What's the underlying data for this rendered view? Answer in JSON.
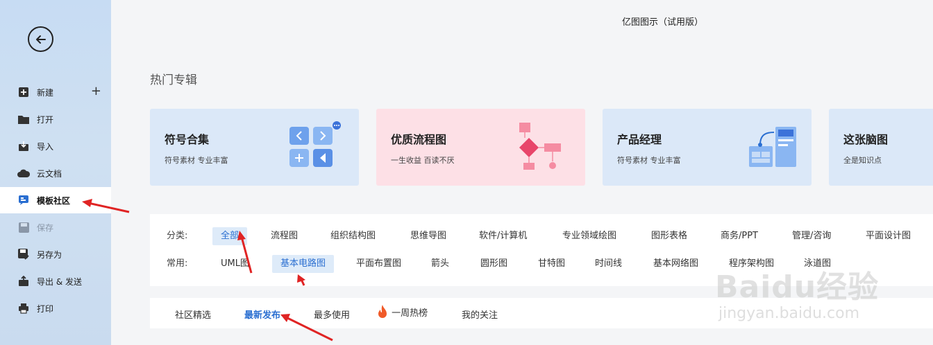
{
  "app_title": "亿图图示（试用版）",
  "sidebar": {
    "items": [
      {
        "label": "新建",
        "icon": "plus-square-icon"
      },
      {
        "label": "打开",
        "icon": "folder-icon"
      },
      {
        "label": "导入",
        "icon": "import-icon"
      },
      {
        "label": "云文档",
        "icon": "cloud-icon"
      },
      {
        "label": "模板社区",
        "icon": "template-community-icon"
      },
      {
        "label": "保存",
        "icon": "save-icon"
      },
      {
        "label": "另存为",
        "icon": "save-as-icon"
      },
      {
        "label": "导出 & 发送",
        "icon": "export-icon"
      },
      {
        "label": "打印",
        "icon": "printer-icon"
      }
    ],
    "active_index": 4,
    "disabled_index": 5
  },
  "section_title": "热门专辑",
  "cards": [
    {
      "title": "符号合集",
      "subtitle": "符号素材 专业丰富",
      "bg": "#dbe8f8"
    },
    {
      "title": "优质流程图",
      "subtitle": "一生收益 百读不厌",
      "bg": "#fde0e6"
    },
    {
      "title": "产品经理",
      "subtitle": "符号素材 专业丰富",
      "bg": "#dbe8f8"
    },
    {
      "title": "这张脑图",
      "subtitle": "全是知识点",
      "bg": "#dbe8f8"
    }
  ],
  "categories": {
    "label": "分类:",
    "items": [
      "全部",
      "流程图",
      "组织结构图",
      "思维导图",
      "软件/计算机",
      "专业领域绘图",
      "图形表格",
      "商务/PPT",
      "管理/咨询",
      "平面设计图"
    ],
    "selected": "全部"
  },
  "common": {
    "label": "常用:",
    "items": [
      "UML图",
      "基本电路图",
      "平面布置图",
      "箭头",
      "圆形图",
      "甘特图",
      "时间线",
      "基本网络图",
      "程序架构图",
      "泳道图"
    ],
    "selected": "基本电路图"
  },
  "tabs": {
    "items": [
      "社区精选",
      "最新发布",
      "最多使用",
      "一周热榜",
      "我的关注"
    ],
    "active": "最新发布"
  },
  "watermark": {
    "main": "Baidu经验",
    "url": "jingyan.baidu.com"
  },
  "colors": {
    "accent": "#2b6fd1",
    "arrow": "#e02424",
    "hot": "#f05a28"
  }
}
